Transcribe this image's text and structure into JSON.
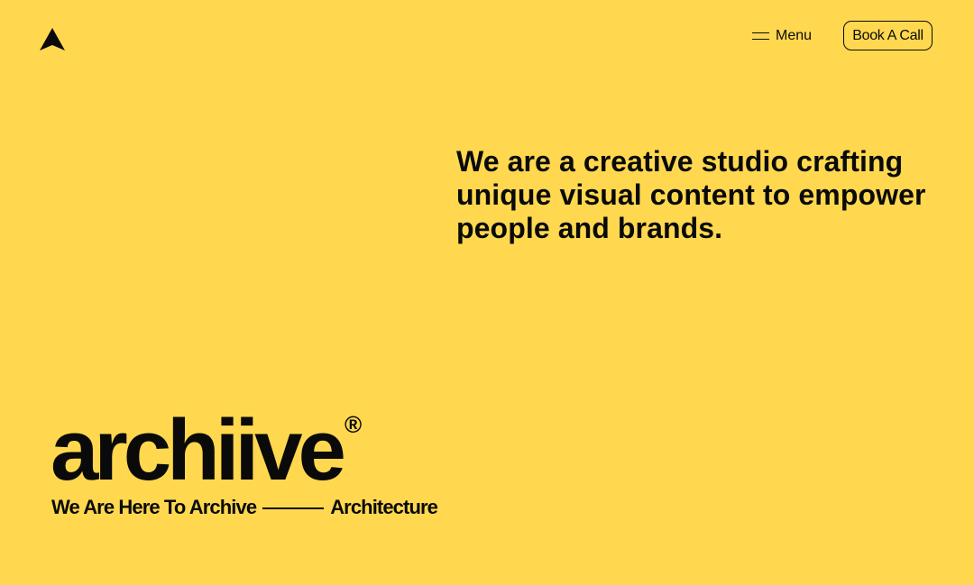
{
  "nav": {
    "logo_icon": "triangle-star-logo",
    "menu_label": "Menu",
    "menu_icon": "hamburger-icon",
    "cta_label": "Book A Call"
  },
  "hero": {
    "tagline": "We are a creative studio crafting unique visual content to empower people and brands."
  },
  "brand": {
    "wordmark": "archiive",
    "registered": "®",
    "subtitle_left": "We Are Here To Archive",
    "subtitle_right": "Architecture"
  },
  "colors": {
    "background": "#FFD84F",
    "foreground": "#0a0a0a"
  }
}
